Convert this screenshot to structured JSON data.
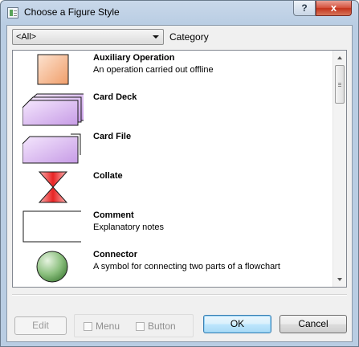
{
  "window": {
    "title": "Choose a Figure Style",
    "help_label": "?",
    "close_label": "x"
  },
  "category": {
    "selected": "<All>",
    "label": "Category"
  },
  "figures": [
    {
      "name": "Auxiliary Operation",
      "description": "An operation carried out offline",
      "icon": "auxiliary-operation-icon",
      "fill": "#f4b48c"
    },
    {
      "name": "Card Deck",
      "description": "",
      "icon": "card-deck-icon",
      "fill": "#d9b6f2"
    },
    {
      "name": "Card File",
      "description": "",
      "icon": "card-file-icon",
      "fill": "#d9b6f2"
    },
    {
      "name": "Collate",
      "description": "",
      "icon": "collate-icon",
      "fill": "#e82424"
    },
    {
      "name": "Comment",
      "description": "Explanatory notes",
      "icon": "comment-icon",
      "fill": "#ffffff"
    },
    {
      "name": "Connector",
      "description": "A symbol for connecting two parts of a flowchart",
      "icon": "connector-icon",
      "fill": "#5aa050"
    }
  ],
  "options": {
    "menu_label": "Menu",
    "button_label": "Button",
    "menu_checked": false,
    "button_checked": false
  },
  "buttons": {
    "edit": "Edit",
    "ok": "OK",
    "cancel": "Cancel"
  }
}
